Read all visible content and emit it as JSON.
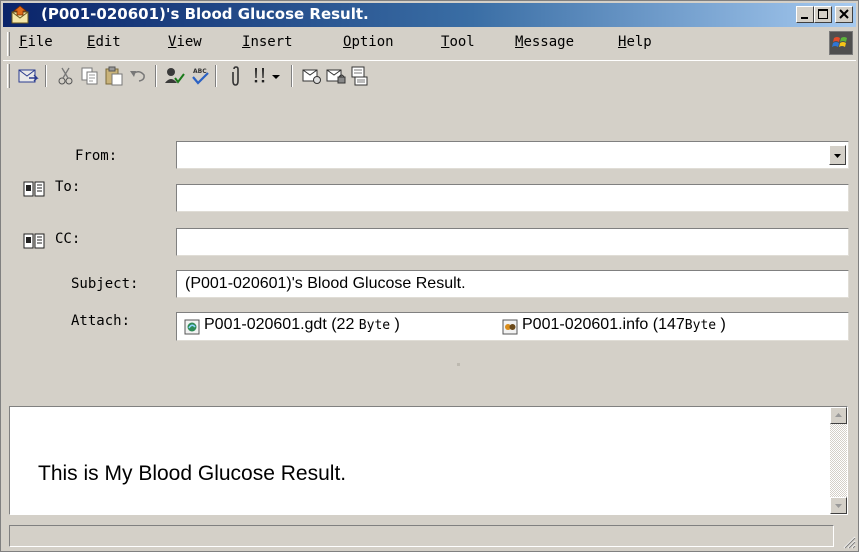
{
  "window": {
    "title": "(P001-020601)'s Blood Glucose Result."
  },
  "menu": [
    "File",
    "Edit",
    "View",
    "Insert",
    "Option",
    "Tool",
    "Message",
    "Help"
  ],
  "toolbar": {
    "icons": [
      "send-icon",
      "cut-icon",
      "copy-icon",
      "paste-icon",
      "undo-icon",
      "check-names-icon",
      "spelling-icon",
      "attach-icon",
      "priority-icon",
      "dropdown-arrow-icon",
      "sign-icon",
      "encrypt-icon",
      "offline-icon"
    ]
  },
  "header": {
    "from": {
      "label": "From:",
      "value": ""
    },
    "to": {
      "label": "To:",
      "value": ""
    },
    "cc": {
      "label": "CC:",
      "value": ""
    },
    "subject": {
      "label": "Subject:",
      "value": "(P001-020601)'s Blood Glucose Result."
    },
    "attach": {
      "label": "Attach:",
      "files": [
        {
          "name": "P001-020601.gdt",
          "size_open": " (22 ",
          "size_unit": "Byte",
          "size_close": " )",
          "icon": "gdt-file-icon"
        },
        {
          "name": "P001-020601.info",
          "size_open": " (147",
          "size_unit": "Byte",
          "size_close": " )",
          "icon": "info-file-icon"
        }
      ]
    }
  },
  "body": {
    "text": "This is My Blood Glucose Result."
  },
  "colors": {
    "title_bar_start": "#0a246a",
    "title_bar_end": "#a6caf0",
    "chrome": "#d4d0c8"
  }
}
